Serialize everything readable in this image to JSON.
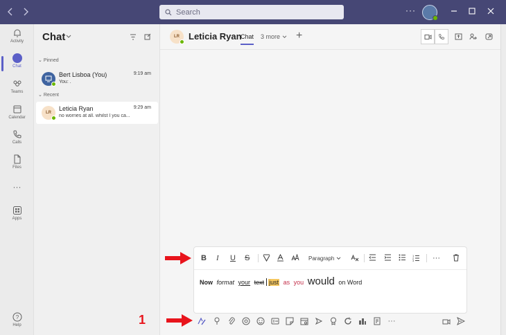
{
  "titlebar": {
    "back_icon": "chevron-left-icon",
    "forward_icon": "chevron-right-icon",
    "search_placeholder": "Search",
    "more_label": "···",
    "window_controls": [
      "minimize",
      "maximize",
      "close"
    ]
  },
  "rail": {
    "items": [
      {
        "label": "Activity",
        "icon": "bell-icon"
      },
      {
        "label": "Chat",
        "icon": "chat-icon",
        "active": true
      },
      {
        "label": "Teams",
        "icon": "teams-icon"
      },
      {
        "label": "Calendar",
        "icon": "calendar-icon"
      },
      {
        "label": "Calls",
        "icon": "phone-icon"
      },
      {
        "label": "Files",
        "icon": "file-icon"
      },
      {
        "label": "Apps",
        "icon": "apps-icon"
      }
    ],
    "more_label": "···",
    "help_label": "Help"
  },
  "chatlist": {
    "title": "Chat",
    "pinned_label": "Pinned",
    "recent_label": "Recent",
    "pinned": [
      {
        "name": "Bert Lisboa (You)",
        "time": "9:19 am",
        "preview": "You: ."
      }
    ],
    "recent": [
      {
        "name": "Leticia Ryan",
        "initials": "LR",
        "time": "9:29 am",
        "preview": "no worries at all. whilst I you ca..."
      }
    ]
  },
  "conversation": {
    "initials": "LR",
    "name": "Leticia Ryan",
    "tab": "Chat",
    "more_tabs": "3 more",
    "add_tab": "+"
  },
  "composer": {
    "paragraph_label": "Paragraph",
    "more_label": "···",
    "text_words": {
      "now": "Now",
      "format": "format",
      "your": "your",
      "text": "text",
      "just": "just",
      "as": "as",
      "you": "you",
      "would": "would",
      "on_word": "on Word"
    }
  },
  "annotation": {
    "number": "1",
    "color": "#e8141c"
  },
  "colors": {
    "titlebar": "#464775",
    "accent": "#5b5fc7",
    "presence": "#6bb700",
    "highlight": "#f5c75f"
  }
}
